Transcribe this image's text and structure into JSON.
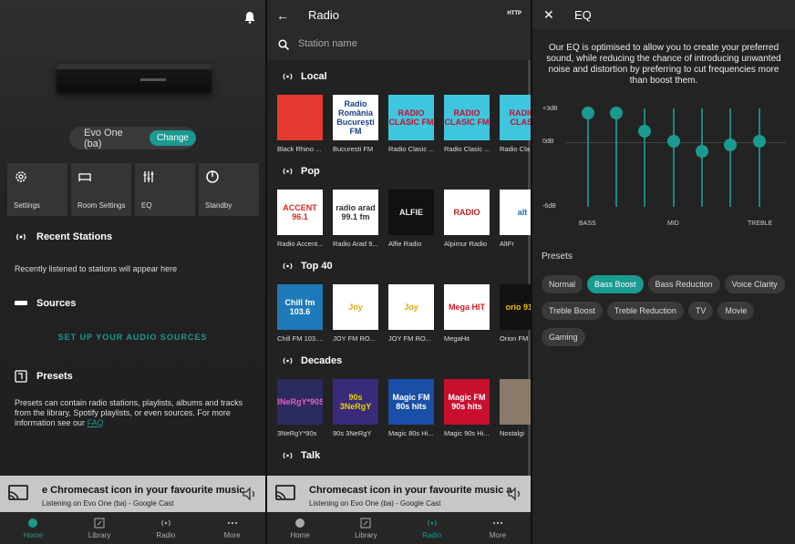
{
  "home": {
    "device_name": "Evo One (ba)",
    "change_label": "Change",
    "tiles": [
      {
        "label": "Settings",
        "icon": "gear-icon"
      },
      {
        "label": "Room Settings",
        "icon": "bed-icon"
      },
      {
        "label": "EQ",
        "icon": "sliders-icon"
      },
      {
        "label": "Standby",
        "icon": "power-icon"
      }
    ],
    "recent_title": "Recent Stations",
    "recent_text": "Recently listened to stations will appear here",
    "sources_title": "Sources",
    "setup_link": "SET UP YOUR AUDIO SOURCES",
    "presets_title": "Presets",
    "presets_text": "Presets can contain radio stations, playlists, albums and tracks from the library, Spotify playlists, or even sources. For more information see our",
    "faq_link": "FAQ"
  },
  "now_playing": {
    "title": "e Chromecast icon in your favourite music",
    "title_alt": "Chromecast icon in your favourite music a",
    "subtitle": "Listening on Evo One (ba) - Google Cast"
  },
  "nav": [
    {
      "label": "Home",
      "icon": "home-icon"
    },
    {
      "label": "Library",
      "icon": "library-icon"
    },
    {
      "label": "Radio",
      "icon": "radio-icon"
    },
    {
      "label": "More",
      "icon": "more-icon"
    }
  ],
  "radio": {
    "title": "Radio",
    "http_label": "HTTP",
    "search_placeholder": "Station name",
    "categories": [
      {
        "name": "Local",
        "stations": [
          {
            "name": "Black Rhino ...",
            "art": "",
            "bg": "#e53a2f",
            "fg": "#fff"
          },
          {
            "name": "Bucuresti FM",
            "art": "Radio România București FM",
            "bg": "#ffffff",
            "fg": "#1b3f8a"
          },
          {
            "name": "Radio Clasic ...",
            "art": "RADIO CLASIC FM",
            "bg": "#3ec6df",
            "fg": "#c8102e"
          },
          {
            "name": "Radio Clasic ...",
            "art": "RADIO CLASIC FM",
            "bg": "#3ec6df",
            "fg": "#c8102e"
          },
          {
            "name": "Radio Cla",
            "art": "RADIO CLASI",
            "bg": "#3ec6df",
            "fg": "#c8102e"
          }
        ]
      },
      {
        "name": "Pop",
        "stations": [
          {
            "name": "Radio Accent...",
            "art": "ACCENT 96.1",
            "bg": "#ffffff",
            "fg": "#d62b1f"
          },
          {
            "name": "Radio Arad 9...",
            "art": "radio arad 99.1 fm",
            "bg": "#ffffff",
            "fg": "#333"
          },
          {
            "name": "Alfie Radio",
            "art": "ALFIE",
            "bg": "#111111",
            "fg": "#eee"
          },
          {
            "name": "Alpimur Radio",
            "art": "RADIO",
            "bg": "#ffffff",
            "fg": "#b22"
          },
          {
            "name": "AltFr",
            "art": "alt",
            "bg": "#ffffff",
            "fg": "#1a6fb5"
          }
        ]
      },
      {
        "name": "Top 40",
        "stations": [
          {
            "name": "Chill FM 103....",
            "art": "Chill fm 103.6",
            "bg": "#1e7ab8",
            "fg": "#fff"
          },
          {
            "name": "JOY FM RO...",
            "art": "Joy",
            "bg": "#ffffff",
            "fg": "#e6a800"
          },
          {
            "name": "JOY FM RO...",
            "art": "Joy",
            "bg": "#ffffff",
            "fg": "#e6a800"
          },
          {
            "name": "MegaHit",
            "art": "Mega HIT",
            "bg": "#ffffff",
            "fg": "#d71920"
          },
          {
            "name": "Orion FM",
            "art": "orio 91.7",
            "bg": "#111111",
            "fg": "#e8c000"
          }
        ]
      },
      {
        "name": "Decades",
        "stations": [
          {
            "name": "3NeRgY*90s",
            "art": "3NeRgY*90S",
            "bg": "#2b2b5e",
            "fg": "#e05fc8"
          },
          {
            "name": "90s 3NeRgY",
            "art": "90s 3NeRgY",
            "bg": "#3a2b7a",
            "fg": "#e8d200"
          },
          {
            "name": "Magic 80s Hi...",
            "art": "Magic FM 80s hits",
            "bg": "#1a4fa8",
            "fg": "#fff"
          },
          {
            "name": "Magic 90s Hi...",
            "art": "Magic FM 90s hits",
            "bg": "#c8102e",
            "fg": "#fff"
          },
          {
            "name": "Nostalgi",
            "art": "",
            "bg": "#8a7a6a",
            "fg": "#fff"
          }
        ]
      },
      {
        "name": "Talk",
        "stations": []
      }
    ]
  },
  "eq": {
    "title": "EQ",
    "description": "Our EQ is optimised to allow you to create your preferred sound, while reducing the chance of introducing unwanted noise and distortion by preferring to cut frequencies more than boost them.",
    "db_labels": [
      "+3dB",
      "0dB",
      "-6dB"
    ],
    "band_labels": [
      "BASS",
      "MID",
      "TREBLE"
    ],
    "bands_db": [
      2.6,
      2.6,
      0.9,
      0.0,
      -0.9,
      -0.3,
      0.0
    ],
    "range_db": [
      -6,
      3
    ],
    "presets_title": "Presets",
    "presets": [
      "Normal",
      "Bass Boost",
      "Bass Reduction",
      "Voice Clarity",
      "Treble Boost",
      "Treble Reduction",
      "TV",
      "Movie",
      "Gaming"
    ],
    "active_preset": "Bass Boost"
  },
  "colors": {
    "accent": "#1a9a90"
  }
}
